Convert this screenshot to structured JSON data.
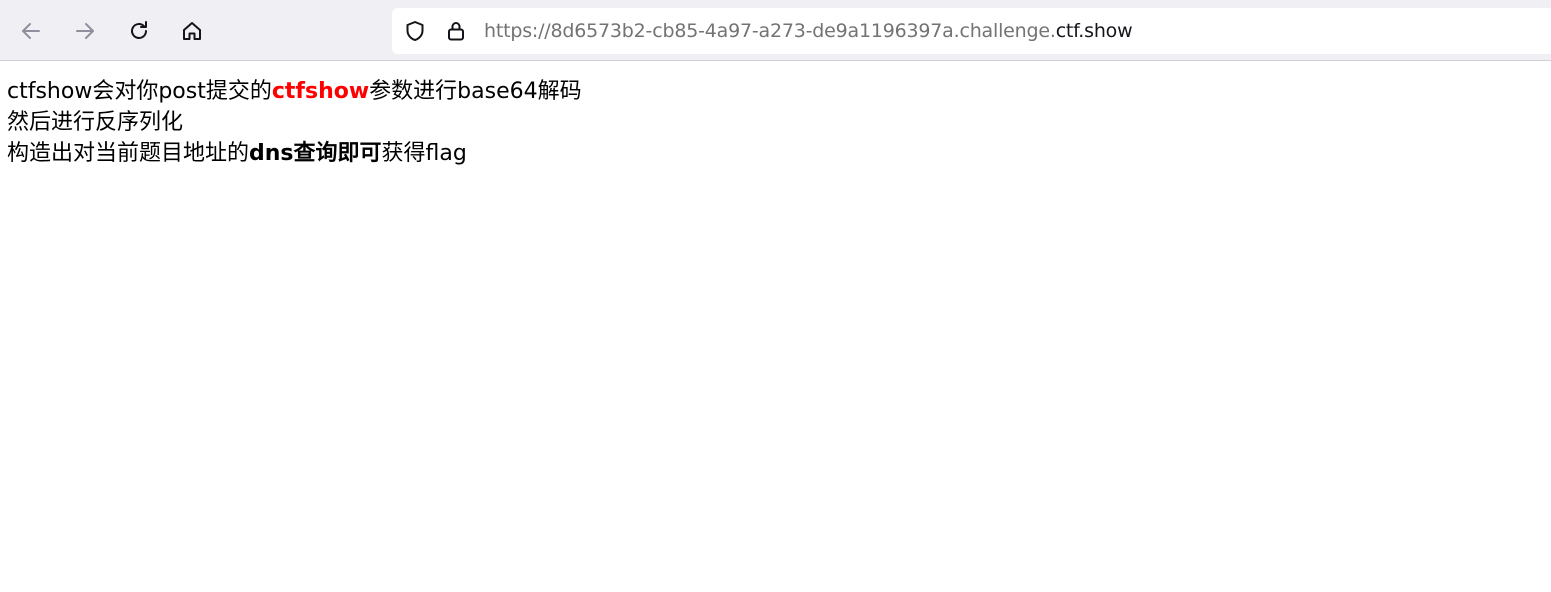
{
  "browser": {
    "icons": {
      "back": "back-arrow-icon",
      "forward": "forward-arrow-icon",
      "reload": "reload-icon",
      "home": "home-icon",
      "tracking_protection": "shield-icon",
      "secure": "lock-icon"
    },
    "url": {
      "prefix": "https://8d6573b2-cb85-4a97-a273-de9a1196397a.challenge.",
      "domain": "ctf.show"
    }
  },
  "page": {
    "line1": {
      "before": "ctfshow会对你post提交的",
      "highlight": "ctfshow",
      "after": "参数进行base64解码"
    },
    "line2": "然后进行反序列化",
    "line3": {
      "before": "构造出对当前题目地址的",
      "bold": "dns查询即可",
      "after": "获得flag"
    }
  },
  "colors": {
    "highlight": "#ff0000",
    "toolbar_bg": "#f0f0f4",
    "url_prefix": "#737373",
    "url_domain": "#15141a"
  }
}
